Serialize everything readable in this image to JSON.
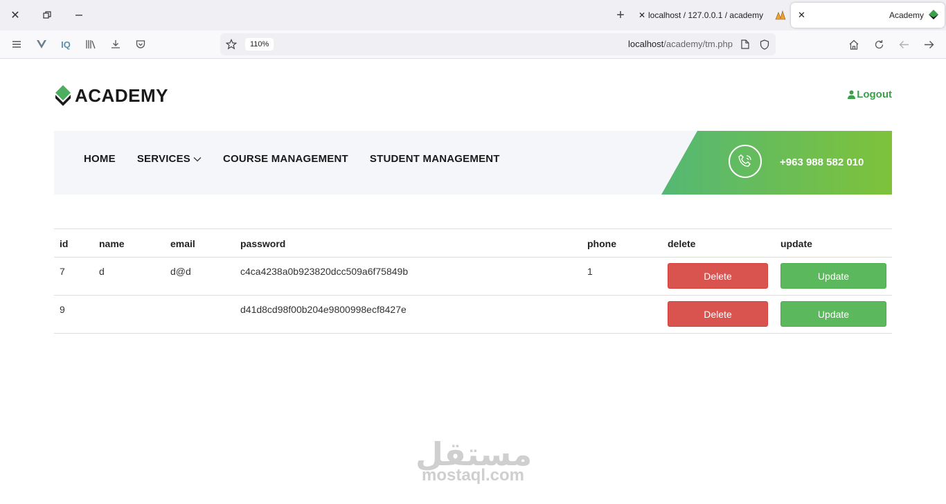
{
  "browser": {
    "tabs": [
      {
        "title": "localhost / 127.0.0.1 / academy"
      },
      {
        "title": "Academy"
      }
    ],
    "zoom": "110%",
    "url_host": "localhost",
    "url_path": "/academy/tm.php"
  },
  "header": {
    "logo_text": "ACADEMY",
    "logout_label": "Logout"
  },
  "nav": {
    "items": [
      {
        "label": "HOME"
      },
      {
        "label": "SERVICES"
      },
      {
        "label": "COURSE MANAGEMENT"
      },
      {
        "label": "STUDENT MANAGEMENT"
      }
    ],
    "phone": "+963 988 582 010"
  },
  "table": {
    "columns": [
      "id",
      "name",
      "email",
      "password",
      "phone",
      "delete",
      "update"
    ],
    "rows": [
      {
        "id": "7",
        "name": "d",
        "email": "d@d",
        "password": "c4ca4238a0b923820dcc509a6f75849b",
        "phone": "1",
        "delete": "Delete",
        "update": "Update"
      },
      {
        "id": "9",
        "name": "",
        "email": "",
        "password": "d41d8cd98f00b204e9800998ecf8427e",
        "phone": "",
        "delete": "Delete",
        "update": "Update"
      }
    ]
  },
  "watermark": {
    "arabic": "مستقل",
    "latin": "mostaql.com"
  },
  "colors": {
    "accent_green": "#3aa04a",
    "delete_red": "#d9534f",
    "update_green": "#5cb85c"
  }
}
